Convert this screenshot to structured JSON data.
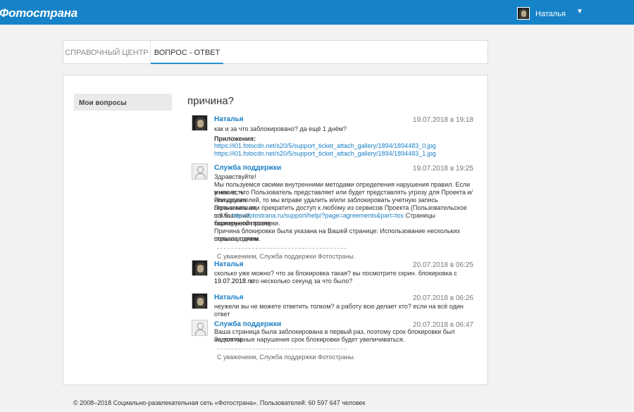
{
  "header": {
    "logo": "Фотострана",
    "user_name": "Наталья",
    "caret": "▼"
  },
  "tabs": [
    {
      "label": "СПРАВОЧНЫЙ ЦЕНТР"
    },
    {
      "label": "ВОПРОС - ОТВЕТ"
    }
  ],
  "sidebar": {
    "my_questions": "Мои вопросы"
  },
  "question": {
    "title": "причина?"
  },
  "messages": [
    {
      "author": "Наталья",
      "date": "19.07.2018 в 19:18",
      "text": "как и за что заблокировано? да ещё 1 днём?",
      "attachments_title": "Приложения:",
      "attachments": [
        "https://i01.fotocdn.net/s20/5/support_ticket_attach_gallery/1894/1894483_0.jpg",
        "https://i01.fotocdn.net/s20/5/support_ticket_attach_gallery/1894/1894483_1.jpg"
      ]
    },
    {
      "author": "Служба поддержки",
      "date": "19.07.2018 в 19:25",
      "lines": [
        "Здравствуйте!",
        "Мы пользуемся своими внутренними методами определения нарушения правил. Если у нас есть",
        "мнение, что Пользователь представляет или будет представлять угрозу для Проекта и/или других",
        "Пользователей, то мы вправе удалить и/или заблокировать учетную запись Пользователя,",
        "ограничить или прекратить доступ к любому из сервисов Проекта (Пользовательское соглашение,",
        "п.6.5. ",
        "tos_link:http://fotostrana.ru/support/help/?page=agreements&part=tos",
        " Страницы блокируются после",
        "тщательной проверки.",
        "Причина блокировки была указана на Вашей странице: Использование нескольких страниц одним",
        "пользователем."
      ],
      "signature": "С уважением, Служба поддержки Фотостраны."
    },
    {
      "author": "Наталья",
      "date": "20.07.2018 в 06:25",
      "lines": [
        "сколько уже можно? что за блокировка такая? вы посмотрите скрин. блокировка с 19.07.2018 по",
        "19.07.2018. это несколько секунд за что было?"
      ]
    },
    {
      "author": "Наталья",
      "date": "20.07.2018 в 06:26",
      "text": "неужели вы не можете ответить толком? а работу всю делает кто? если на всё один ответ"
    },
    {
      "author": "Служба поддержки",
      "date": "20.07.2018 в 06:47",
      "lines": [
        "Ваша страница была заблокирована в первый раз, поэтому срок блокировки был недолгим.",
        "За повторные нарушения срок блокировки будет увеличиваться."
      ],
      "signature": "С уважением, Служба поддержки Фотостраны."
    }
  ],
  "footer": {
    "text": "© 2008–2018 Социально-развлекательная сеть «Фотострана». Пользователей: 60 597 647 человек"
  },
  "colors": {
    "topbar": "#1683c8",
    "link": "#1a7ec4",
    "active_tab_underline": "#2490d7"
  }
}
